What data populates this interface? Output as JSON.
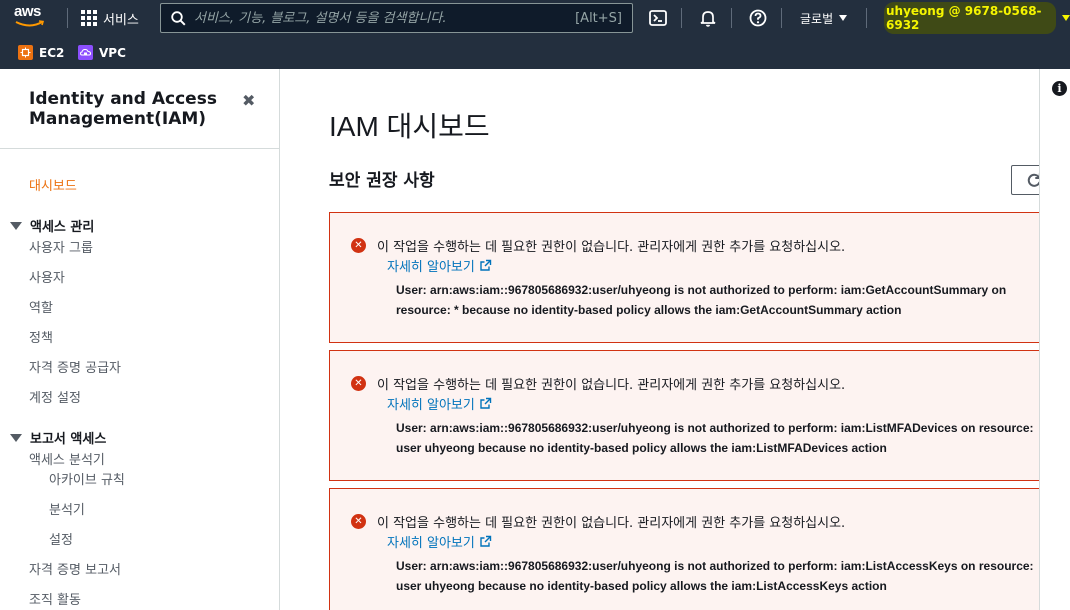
{
  "topnav": {
    "logo_text": "aws",
    "services_label": "서비스",
    "search_placeholder": "서비스, 기능, 블로그, 설명서 등을 검색합니다.",
    "search_shortcut": "[Alt+S]",
    "region_label": "글로벌",
    "account_label": "uhyeong @ 9678-0568-6932"
  },
  "favorites": [
    {
      "label": "EC2",
      "color": "#ec7211"
    },
    {
      "label": "VPC",
      "color": "#8c4fff"
    }
  ],
  "sidebar": {
    "title_line1": "Identity and Access",
    "title_line2": "Management(IAM)",
    "close": "✖",
    "dashboard": "대시보드",
    "access_management": {
      "title": "액세스 관리",
      "items": [
        "사용자 그룹",
        "사용자",
        "역할",
        "정책",
        "자격 증명 공급자",
        "계정 설정"
      ]
    },
    "reports": {
      "title": "보고서 액세스",
      "analyzer": "액세스 분석기",
      "analyzer_items": [
        "아카이브 규칙",
        "분석기",
        "설정"
      ],
      "items": [
        "자격 증명 보고서",
        "조직 활동"
      ]
    }
  },
  "main": {
    "page_title": "IAM 대시보드",
    "section_title": "보안 권장 사항",
    "alerts": [
      {
        "message": "이 작업을 수행하는 데 필요한 권한이 없습니다. 관리자에게 권한 추가를 요청하십시오.",
        "link": "자세히 알아보기",
        "detail": "User: arn:aws:iam::967805686932:user/uhyeong is not authorized to perform: iam:GetAccountSummary on resource: * because no identity-based policy allows the iam:GetAccountSummary action"
      },
      {
        "message": "이 작업을 수행하는 데 필요한 권한이 없습니다. 관리자에게 권한 추가를 요청하십시오.",
        "link": "자세히 알아보기",
        "detail": "User: arn:aws:iam::967805686932:user/uhyeong is not authorized to perform: iam:ListMFADevices on resource: user uhyeong because no identity-based policy allows the iam:ListMFADevices action"
      },
      {
        "message": "이 작업을 수행하는 데 필요한 권한이 없습니다. 관리자에게 권한 추가를 요청하십시오.",
        "link": "자세히 알아보기",
        "detail": "User: arn:aws:iam::967805686932:user/uhyeong is not authorized to perform: iam:ListAccessKeys on resource: user uhyeong because no identity-based policy allows the iam:ListAccessKeys action"
      }
    ]
  },
  "colors": {
    "nav_bg": "#232f3e",
    "accent_orange": "#ec7211",
    "error_red": "#d13212",
    "link_blue": "#0073bb",
    "account_yellow": "#f5f500"
  },
  "icons": [
    "grid-icon",
    "search-icon",
    "cloudshell-icon",
    "bell-icon",
    "help-icon",
    "close-icon",
    "refresh-icon",
    "error-icon",
    "external-link-icon",
    "info-icon"
  ]
}
